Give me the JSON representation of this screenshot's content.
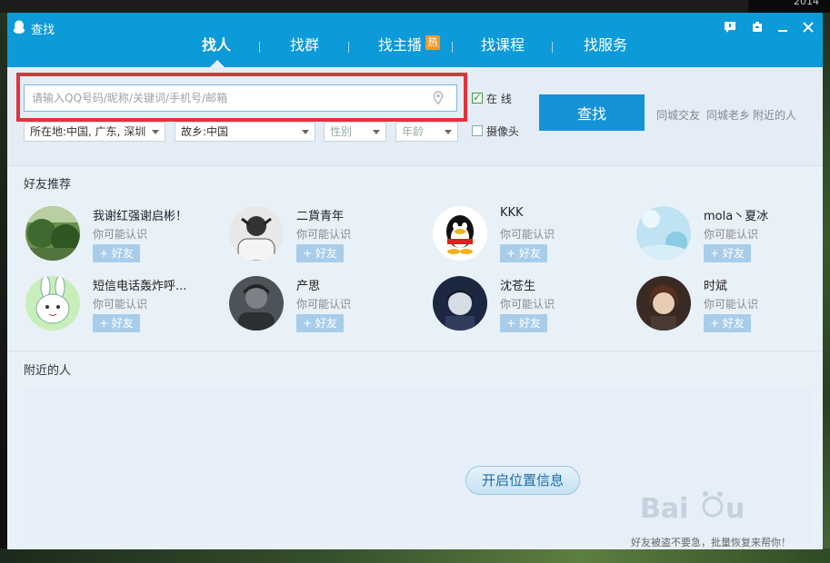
{
  "desktop": {
    "corner_text": "2014"
  },
  "window": {
    "title": "查找"
  },
  "tabs": [
    {
      "label": "找人",
      "active": true
    },
    {
      "label": "找群"
    },
    {
      "label": "找主播",
      "badge": "热"
    },
    {
      "label": "找课程"
    },
    {
      "label": "找服务"
    }
  ],
  "search": {
    "placeholder": "请输入QQ号码/昵称/关键词/手机号/邮箱",
    "online_label": "在  线",
    "online_checked": true,
    "camera_label": "摄像头",
    "camera_checked": false,
    "button_label": "查找",
    "location": "所在地:中国, 广东, 深圳",
    "hometown": "故乡:中国",
    "gender": "性别",
    "age": "年龄",
    "quick_links": [
      "同城交友",
      "同城老乡",
      "附近的人"
    ]
  },
  "recommend": {
    "title": "好友推荐",
    "sub_text": "你可能认识",
    "add_label": "+ 好友",
    "friends": [
      {
        "name": "我谢红强谢启彬！",
        "avatar": "nature-avatar"
      },
      {
        "name": "二貨青年",
        "avatar": "bw-person-avatar"
      },
      {
        "name": "KKK",
        "avatar": "qq-penguin-avatar"
      },
      {
        "name": "mola丶夏冰",
        "avatar": "sky-avatar"
      },
      {
        "name": "短信电话轰炸呼...",
        "avatar": "cartoon-rabbit-avatar"
      },
      {
        "name": "产思",
        "avatar": "dark-portrait-avatar"
      },
      {
        "name": "沈苍生",
        "avatar": "anime-boy-avatar"
      },
      {
        "name": "时斌",
        "avatar": "anime-girl-avatar"
      }
    ]
  },
  "nearby": {
    "title": "附近的人",
    "button_label": "开启位置信息"
  },
  "footer": {
    "tip": "好友被盗不要急，批量恢复来帮你！"
  },
  "colors": {
    "title_bar": "#0d9ad9",
    "button": "#1592d8",
    "highlight_box": "#e0333b"
  }
}
